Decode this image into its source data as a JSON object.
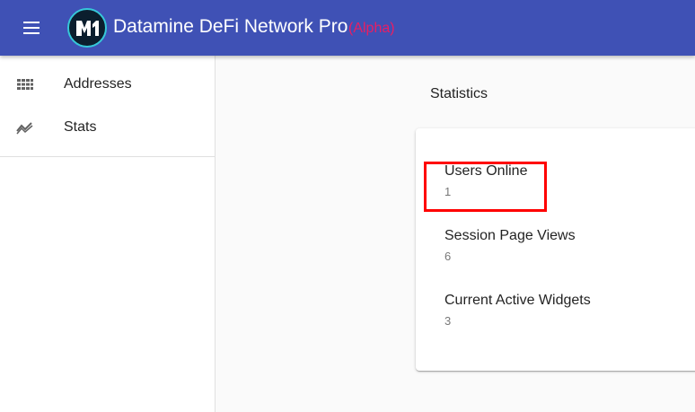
{
  "appbar": {
    "title": "Datamine DeFi Network Pro",
    "badge": "(Alpha)",
    "background_color": "#3f51b5",
    "badge_color": "#e91e63",
    "menu_icon": "menu-icon",
    "logo_icon": "datamine-logo-icon"
  },
  "sidebar": {
    "items": [
      {
        "label": "Addresses",
        "icon": "grid-icon"
      },
      {
        "label": "Stats",
        "icon": "trending-icon"
      }
    ]
  },
  "main": {
    "section_title": "Statistics",
    "stats": [
      {
        "label": "Users Online",
        "value": "1"
      },
      {
        "label": "Session Page Views",
        "value": "6"
      },
      {
        "label": "Current Active Widgets",
        "value": "3"
      }
    ],
    "highlight_color": "#ff0000"
  }
}
